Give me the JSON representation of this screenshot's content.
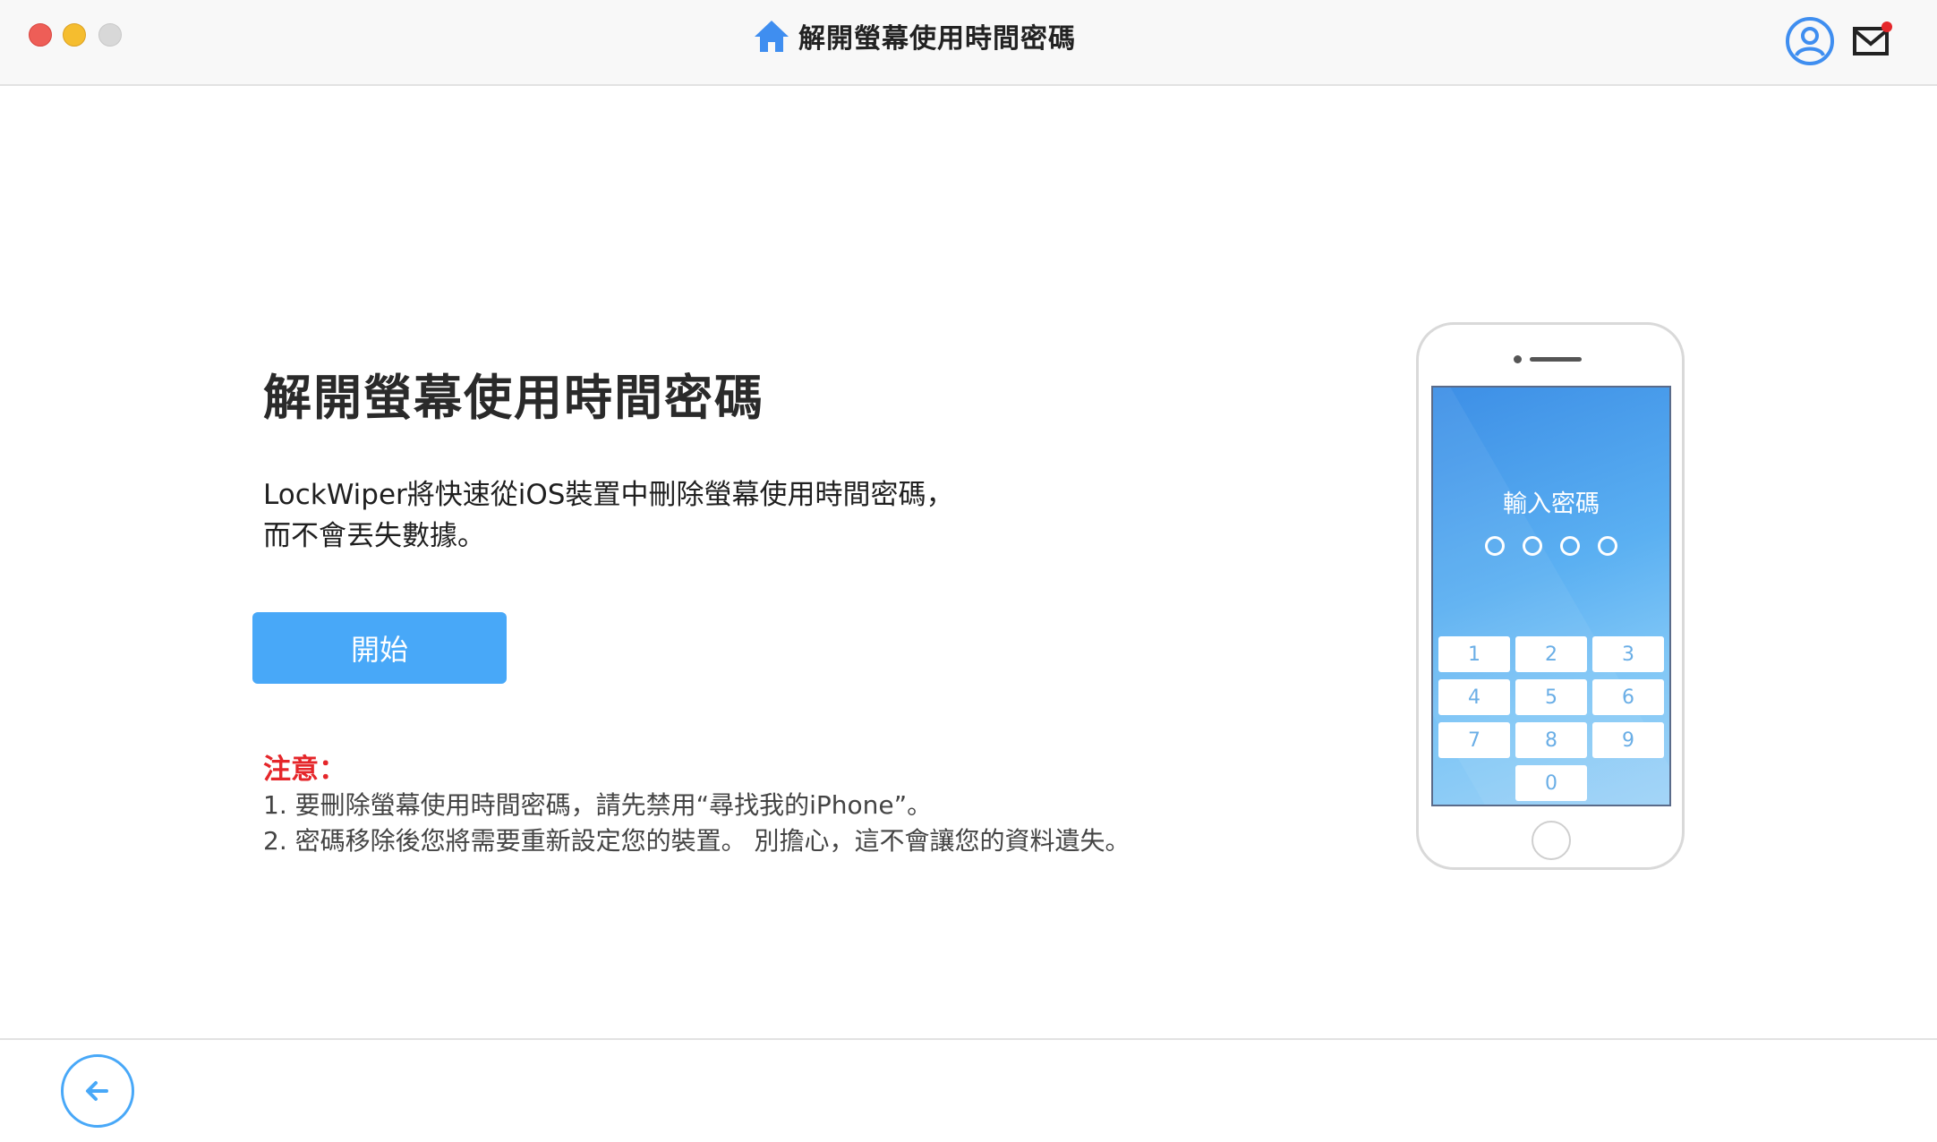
{
  "window": {
    "title": "解開螢幕使用時間密碼"
  },
  "header": {
    "home_icon": "home-icon",
    "user_icon": "user-avatar-icon",
    "mail_icon": "mail-icon",
    "mail_has_notification": true
  },
  "main": {
    "heading": "解開螢幕使用時間密碼",
    "description_line1": "LockWiper將快速從iOS裝置中刪除螢幕使用時間密碼，",
    "description_line2": "而不會丟失數據。",
    "start_button": "開始",
    "note_title": "注意：",
    "notes": [
      "1. 要刪除螢幕使用時間密碼，請先禁用“尋找我的iPhone”。",
      "2. 密碼移除後您將需要重新設定您的裝置。 別擔心，這不會讓您的資料遺失。"
    ]
  },
  "phone": {
    "prompt": "輸入密碼",
    "keys": [
      "1",
      "2",
      "3",
      "4",
      "5",
      "6",
      "7",
      "8",
      "9",
      "0"
    ]
  },
  "footer": {
    "back_icon": "back-arrow-icon"
  },
  "colors": {
    "accent": "#48a8f8",
    "warning": "#e5262a",
    "notification": "#e5262a"
  }
}
